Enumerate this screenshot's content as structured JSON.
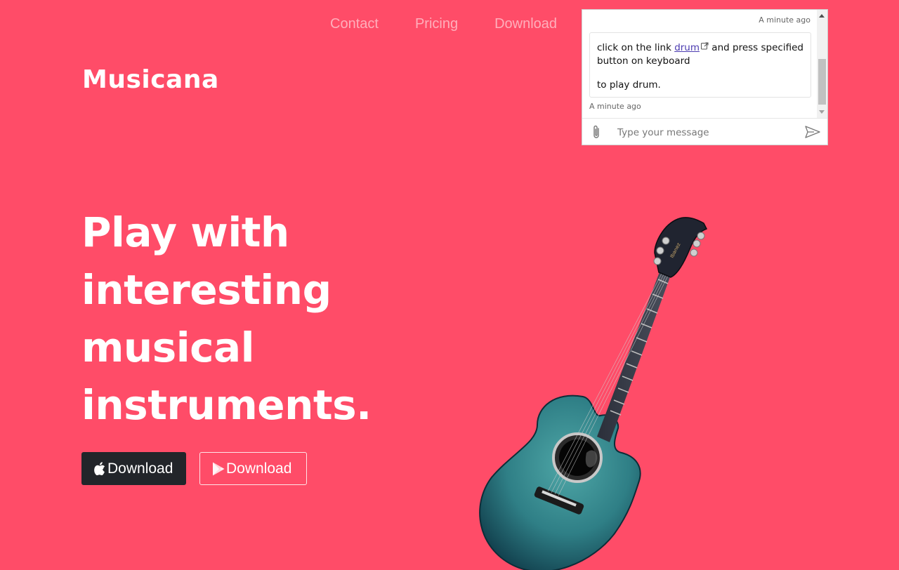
{
  "nav": {
    "items": [
      "Contact",
      "Pricing",
      "Download"
    ]
  },
  "brand": "Musicana",
  "hero": {
    "lines": [
      "Play with",
      "interesting",
      "musical",
      "instruments."
    ],
    "buttons": [
      {
        "label": "Download",
        "icon": "apple-icon"
      },
      {
        "label": "Download",
        "icon": "play-store-icon"
      }
    ]
  },
  "chat": {
    "timestamp_top": "A minute ago",
    "message_prefix": "click on the link ",
    "link_text": "drum",
    "message_suffix": " and press specified button on keyboard",
    "message_second": "to play drum.",
    "timestamp_bottom": "A minute ago",
    "input_placeholder": "Type your message"
  },
  "colors": {
    "background": "#ff4c68",
    "dark_button": "#22252a",
    "link": "#4b3bb0"
  }
}
